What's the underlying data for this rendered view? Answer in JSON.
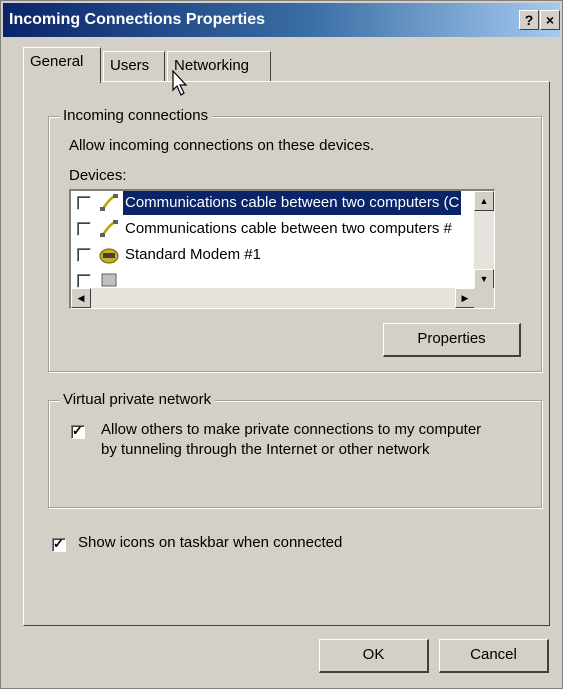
{
  "window": {
    "title": "Incoming Connections Properties",
    "help_label": "?",
    "close_label": "×"
  },
  "tabs": [
    {
      "label": "General",
      "active": true
    },
    {
      "label": "Users",
      "active": false
    },
    {
      "label": "Networking",
      "active": false
    }
  ],
  "incoming": {
    "group_label": "Incoming connections",
    "description": "Allow incoming connections on these devices.",
    "devices_label": "Devices:",
    "devices": [
      {
        "label": "Communications cable between two computers (C",
        "checked": false,
        "selected": true,
        "icon": "cable-icon"
      },
      {
        "label": "Communications cable between two computers #",
        "checked": false,
        "selected": false,
        "icon": "cable-icon"
      },
      {
        "label": "Standard Modem #1",
        "checked": false,
        "selected": false,
        "icon": "modem-icon"
      },
      {
        "label": "",
        "checked": false,
        "selected": false,
        "icon": "device-icon"
      }
    ],
    "properties_button": "Properties"
  },
  "vpn": {
    "group_label": "Virtual private network",
    "checkbox_line1": "Allow others to make private connections to my computer",
    "checkbox_line2": "by tunneling through the Internet or other network",
    "checked": true
  },
  "taskbar": {
    "label": "Show icons on taskbar when connected",
    "checked": true
  },
  "footer": {
    "ok_label": "OK",
    "cancel_label": "Cancel"
  },
  "colors": {
    "face": "#d4d0c8",
    "title_start": "#0a246a",
    "title_end": "#a6caf0",
    "selection": "#0a246a"
  }
}
